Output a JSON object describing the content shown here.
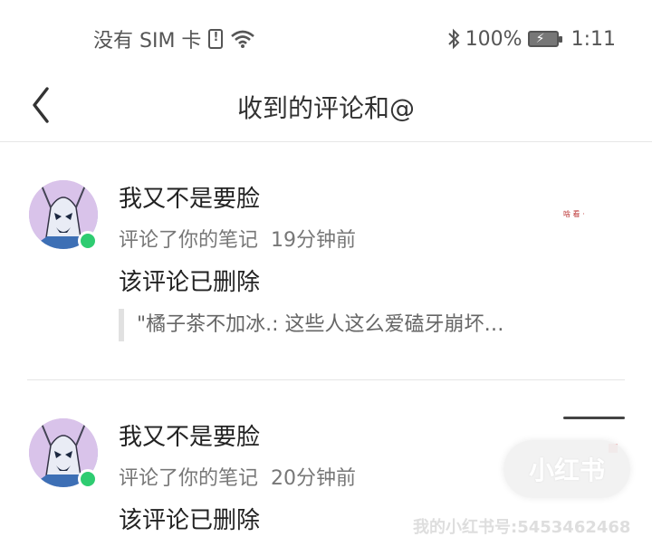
{
  "status_bar": {
    "sim_text": "没有 SIM 卡",
    "battery_pct": "100%",
    "time": "1:11"
  },
  "header": {
    "title": "收到的评论和@"
  },
  "items": [
    {
      "name": "我又不是要脸",
      "action": "评论了你的笔记",
      "time": "19分钟前",
      "comment": "该评论已删除",
      "quote": "\"橘子茶不加冰.: 这些人这么爱磕牙崩坏…",
      "thumb_text": "啥 看 ·"
    },
    {
      "name": "我又不是要脸",
      "action": "评论了你的笔记",
      "time": "20分钟前",
      "comment": "该评论已删除"
    }
  ],
  "watermark": {
    "logo": "小红书",
    "id_text": "我的小红书号:5453462468"
  }
}
